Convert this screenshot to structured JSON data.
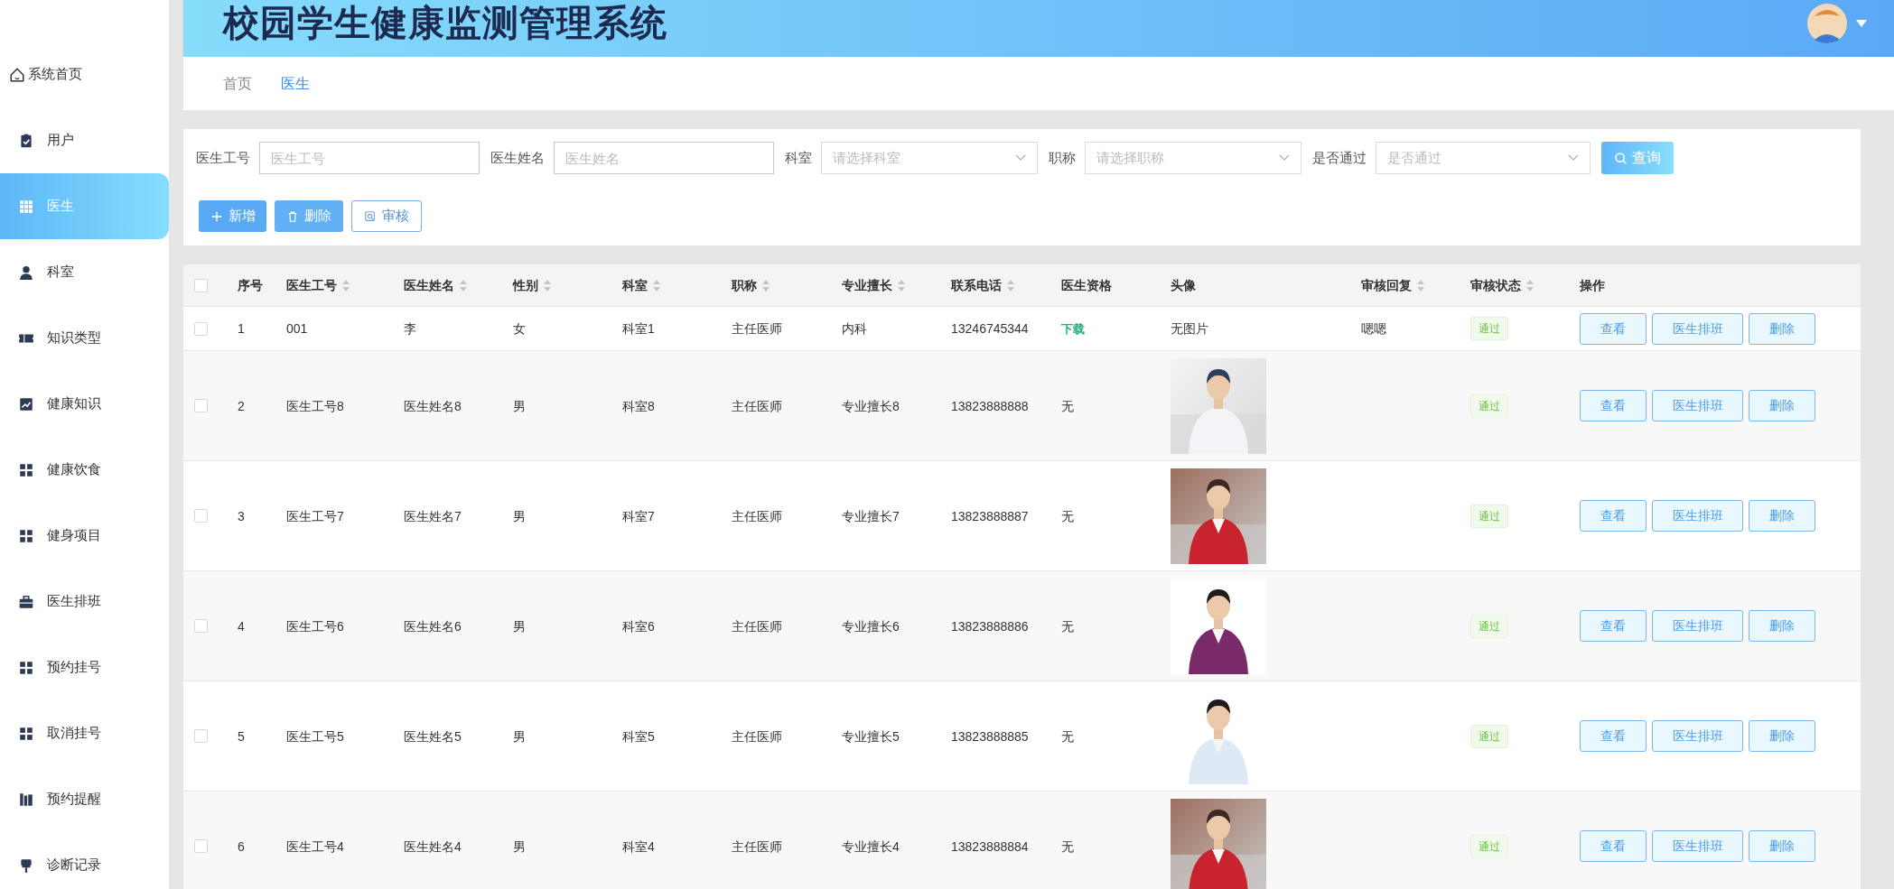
{
  "header": {
    "title": "校园学生健康监测管理系统"
  },
  "sidebar": {
    "items": [
      {
        "label": "系统首页",
        "selected": false
      },
      {
        "label": "用户",
        "selected": false
      },
      {
        "label": "医生",
        "selected": true
      },
      {
        "label": "科室",
        "selected": false
      },
      {
        "label": "知识类型",
        "selected": false
      },
      {
        "label": "健康知识",
        "selected": false
      },
      {
        "label": "健康饮食",
        "selected": false
      },
      {
        "label": "健身项目",
        "selected": false
      },
      {
        "label": "医生排班",
        "selected": false
      },
      {
        "label": "预约挂号",
        "selected": false
      },
      {
        "label": "取消挂号",
        "selected": false
      },
      {
        "label": "预约提醒",
        "selected": false
      },
      {
        "label": "诊断记录",
        "selected": false
      }
    ]
  },
  "breadcrumb": [
    {
      "label": "首页",
      "current": false
    },
    {
      "label": "医生",
      "current": true
    }
  ],
  "search": {
    "fields": [
      {
        "label": "医生工号",
        "placeholder": "医生工号",
        "kind": "input"
      },
      {
        "label": "医生姓名",
        "placeholder": "医生姓名",
        "kind": "input"
      },
      {
        "label": "科室",
        "placeholder": "请选择科室",
        "kind": "select"
      },
      {
        "label": "职称",
        "placeholder": "请选择职称",
        "kind": "select"
      },
      {
        "label": "是否通过",
        "placeholder": "是否通过",
        "kind": "select"
      }
    ],
    "submit": "查询"
  },
  "actions": [
    {
      "label": "新增",
      "kind": "add"
    },
    {
      "label": "删除",
      "kind": "delete"
    },
    {
      "label": "审核",
      "kind": "review"
    }
  ],
  "table": {
    "all_checked": false,
    "columns": [
      {
        "label": "序号",
        "sortable": false
      },
      {
        "label": "医生工号",
        "sortable": true
      },
      {
        "label": "医生姓名",
        "sortable": true
      },
      {
        "label": "性别",
        "sortable": true
      },
      {
        "label": "科室",
        "sortable": true
      },
      {
        "label": "职称",
        "sortable": true
      },
      {
        "label": "专业擅长",
        "sortable": true
      },
      {
        "label": "联系电话",
        "sortable": true
      },
      {
        "label": "医生资格",
        "sortable": false
      },
      {
        "label": "头像",
        "sortable": false
      },
      {
        "label": "审核回复",
        "sortable": true
      },
      {
        "label": "审核状态",
        "sortable": true
      },
      {
        "label": "操作",
        "sortable": false
      }
    ],
    "rows": [
      {
        "checked": false,
        "cells": [
          "1",
          "001",
          "李",
          "女",
          "科室1",
          "主任医师",
          "内科",
          "13246745344"
        ],
        "qualification": {
          "kind": "link",
          "text": "下载"
        },
        "avatar": {
          "kind": "text",
          "text": "无图片"
        },
        "reply": "嗯嗯",
        "status": "通过",
        "buttons": [
          "查看",
          "医生排班",
          "删除"
        ]
      },
      {
        "checked": false,
        "cells": [
          "2",
          "医生工号8",
          "医生姓名8",
          "男",
          "科室8",
          "主任医师",
          "专业擅长8",
          "13823888888"
        ],
        "qualification": {
          "kind": "text",
          "text": "无"
        },
        "status": "通过",
        "buttons": [
          "查看",
          "医生排班",
          "删除"
        ]
      },
      {
        "checked": false,
        "cells": [
          "3",
          "医生工号7",
          "医生姓名7",
          "男",
          "科室7",
          "主任医师",
          "专业擅长7",
          "13823888887"
        ],
        "qualification": {
          "kind": "text",
          "text": "无"
        },
        "status": "通过",
        "buttons": [
          "查看",
          "医生排班",
          "删除"
        ]
      },
      {
        "checked": false,
        "cells": [
          "4",
          "医生工号6",
          "医生姓名6",
          "男",
          "科室6",
          "主任医师",
          "专业擅长6",
          "13823888886"
        ],
        "qualification": {
          "kind": "text",
          "text": "无"
        },
        "status": "通过",
        "buttons": [
          "查看",
          "医生排班",
          "删除"
        ]
      },
      {
        "checked": false,
        "cells": [
          "5",
          "医生工号5",
          "医生姓名5",
          "男",
          "科室5",
          "主任医师",
          "专业擅长5",
          "13823888885"
        ],
        "qualification": {
          "kind": "text",
          "text": "无"
        },
        "status": "通过",
        "buttons": [
          "查看",
          "医生排班",
          "删除"
        ]
      },
      {
        "checked": false,
        "cells": [
          "6",
          "医生工号4",
          "医生姓名4",
          "男",
          "科室4",
          "主任医师",
          "专业擅长4",
          "13823888884"
        ],
        "qualification": {
          "kind": "text",
          "text": "无"
        },
        "status": "通过",
        "buttons": [
          "查看",
          "医生排班",
          "删除"
        ]
      }
    ]
  }
}
